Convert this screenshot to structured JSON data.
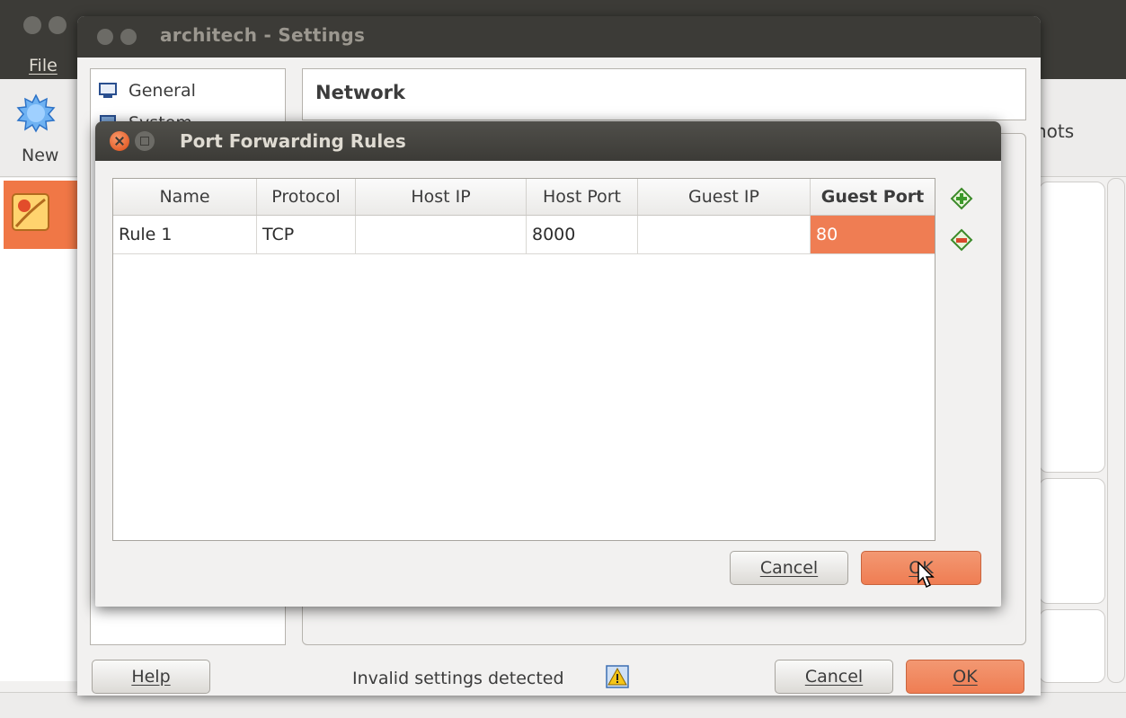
{
  "manager": {
    "menu": {
      "file": "File"
    },
    "toolbar": {
      "new_label": "New",
      "snapshots_fragment": "hots"
    }
  },
  "settings": {
    "title": "architech - Settings",
    "nav": [
      {
        "label": "General",
        "icon": "monitor-icon"
      },
      {
        "label": "System",
        "icon": "chip-icon"
      }
    ],
    "page_title": "Network",
    "help_label": "Help",
    "status_text": "Invalid settings detected",
    "cancel_label": "Cancel",
    "ok_label": "OK"
  },
  "port_forwarding": {
    "title": "Port Forwarding Rules",
    "columns": [
      "Name",
      "Protocol",
      "Host IP",
      "Host Port",
      "Guest IP",
      "Guest Port"
    ],
    "sorted_column": "Guest Port",
    "rows": [
      {
        "name": "Rule 1",
        "protocol": "TCP",
        "host_ip": "",
        "host_port": "8000",
        "guest_ip": "",
        "guest_port": "80"
      }
    ],
    "selected_cell": "Guest Port",
    "cancel_label": "Cancel",
    "ok_label": "OK"
  },
  "colors": {
    "accent": "#ef7d53",
    "titlebar": "#3c3b37",
    "window_bg": "#f2f1f0"
  }
}
